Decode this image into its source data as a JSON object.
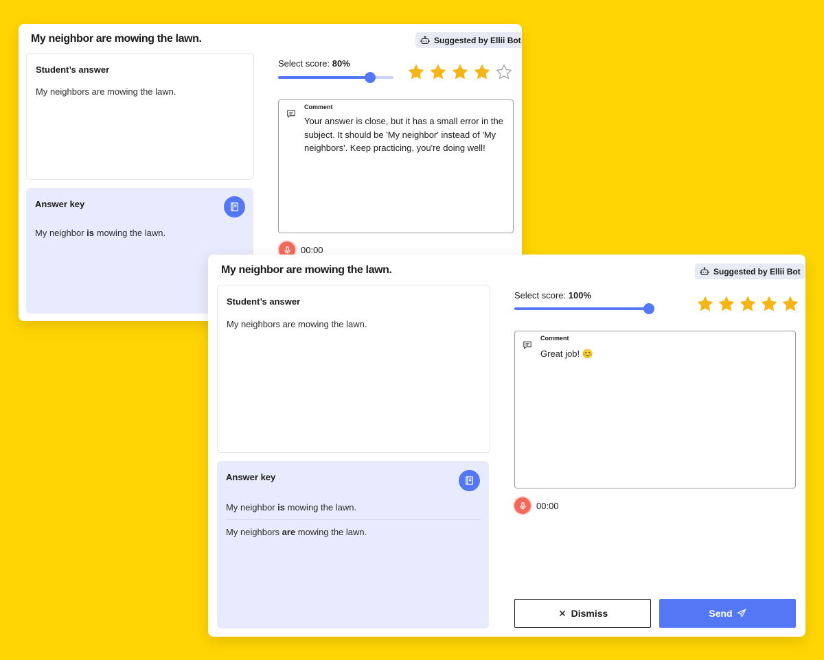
{
  "back_card": {
    "title": "My neighbor are mowing the lawn.",
    "badge_label": "Suggested by Ellii Bot",
    "student_answer": {
      "heading": "Student’s answer",
      "text": "My neighbors are mowing the lawn."
    },
    "answer_key": {
      "heading": "Answer key",
      "rows": [
        {
          "before": "My neighbor ",
          "bold": "is",
          "after": " mowing the lawn."
        }
      ]
    },
    "score": {
      "prefix": "Select score: ",
      "value_label": "80%",
      "value": 0.8
    },
    "rating": {
      "filled": 4,
      "total": 5
    },
    "comment": {
      "label": "Comment",
      "text": "Your answer is close, but it has a small error in the subject. It should be 'My neighbor' instead of 'My neighbors'. Keep practicing, you're doing well!"
    },
    "audio_time": "00:00"
  },
  "front_card": {
    "title": "My neighbor are mowing the lawn.",
    "badge_label": "Suggested by Ellii Bot",
    "student_answer": {
      "heading": "Student’s answer",
      "text": "My neighbors are mowing the lawn."
    },
    "answer_key": {
      "heading": "Answer key",
      "rows": [
        {
          "before": "My neighbor ",
          "bold": "is",
          "after": " mowing the lawn."
        },
        {
          "before": "My neighbors ",
          "bold": "are",
          "after": " mowing the lawn."
        }
      ]
    },
    "score": {
      "prefix": "Select score: ",
      "value_label": "100%",
      "value": 1.0
    },
    "rating": {
      "filled": 5,
      "total": 5
    },
    "comment": {
      "label": "Comment",
      "text": "Great job! 😊"
    },
    "audio_time": "00:00",
    "dismiss_label": "Dismiss",
    "send_label": "Send"
  },
  "icons": {
    "badge": "robot-icon",
    "answer_key": "book-icon",
    "comment": "comment-icon",
    "audio": "microphone-icon",
    "dismiss": "close-icon",
    "send": "paper-plane-icon",
    "rating": "star-icon"
  },
  "colors": {
    "background": "#FFD503",
    "accent": "#5478F5",
    "star": "#F5B516",
    "key_panel": "#E8EBFD",
    "mic": "#F2685A"
  }
}
